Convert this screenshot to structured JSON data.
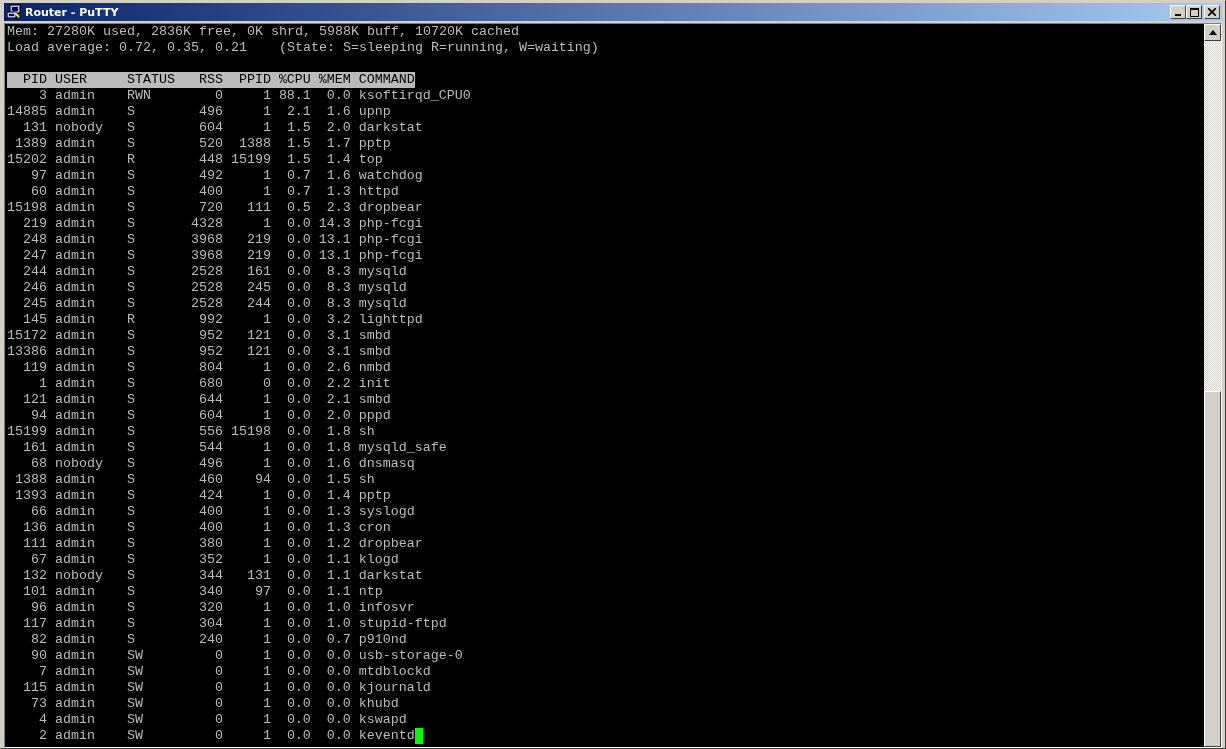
{
  "window": {
    "title": "Router - PuTTY"
  },
  "summary_lines": [
    "Mem: 27280K used, 2836K free, 0K shrd, 5988K buff, 10720K cached",
    "Load average: 0.72, 0.35, 0.21    (State: S=sleeping R=running, W=waiting)"
  ],
  "table": {
    "columns": [
      "PID",
      "USER",
      "STATUS",
      "RSS",
      "PPID",
      "%CPU",
      "%MEM",
      "COMMAND"
    ],
    "rows": [
      [
        "3",
        "admin",
        "RWN",
        "0",
        "1",
        "88.1",
        "0.0",
        "ksoftirqd_CPU0"
      ],
      [
        "14885",
        "admin",
        "S",
        "496",
        "1",
        "2.1",
        "1.6",
        "upnp"
      ],
      [
        "131",
        "nobody",
        "S",
        "604",
        "1",
        "1.5",
        "2.0",
        "darkstat"
      ],
      [
        "1389",
        "admin",
        "S",
        "520",
        "1388",
        "1.5",
        "1.7",
        "pptp"
      ],
      [
        "15202",
        "admin",
        "R",
        "448",
        "15199",
        "1.5",
        "1.4",
        "top"
      ],
      [
        "97",
        "admin",
        "S",
        "492",
        "1",
        "0.7",
        "1.6",
        "watchdog"
      ],
      [
        "60",
        "admin",
        "S",
        "400",
        "1",
        "0.7",
        "1.3",
        "httpd"
      ],
      [
        "15198",
        "admin",
        "S",
        "720",
        "111",
        "0.5",
        "2.3",
        "dropbear"
      ],
      [
        "219",
        "admin",
        "S",
        "4328",
        "1",
        "0.0",
        "14.3",
        "php-fcgi"
      ],
      [
        "248",
        "admin",
        "S",
        "3968",
        "219",
        "0.0",
        "13.1",
        "php-fcgi"
      ],
      [
        "247",
        "admin",
        "S",
        "3968",
        "219",
        "0.0",
        "13.1",
        "php-fcgi"
      ],
      [
        "244",
        "admin",
        "S",
        "2528",
        "161",
        "0.0",
        "8.3",
        "mysqld"
      ],
      [
        "246",
        "admin",
        "S",
        "2528",
        "245",
        "0.0",
        "8.3",
        "mysqld"
      ],
      [
        "245",
        "admin",
        "S",
        "2528",
        "244",
        "0.0",
        "8.3",
        "mysqld"
      ],
      [
        "145",
        "admin",
        "R",
        "992",
        "1",
        "0.0",
        "3.2",
        "lighttpd"
      ],
      [
        "15172",
        "admin",
        "S",
        "952",
        "121",
        "0.0",
        "3.1",
        "smbd"
      ],
      [
        "13386",
        "admin",
        "S",
        "952",
        "121",
        "0.0",
        "3.1",
        "smbd"
      ],
      [
        "119",
        "admin",
        "S",
        "804",
        "1",
        "0.0",
        "2.6",
        "nmbd"
      ],
      [
        "1",
        "admin",
        "S",
        "680",
        "0",
        "0.0",
        "2.2",
        "init"
      ],
      [
        "121",
        "admin",
        "S",
        "644",
        "1",
        "0.0",
        "2.1",
        "smbd"
      ],
      [
        "94",
        "admin",
        "S",
        "604",
        "1",
        "0.0",
        "2.0",
        "pppd"
      ],
      [
        "15199",
        "admin",
        "S",
        "556",
        "15198",
        "0.0",
        "1.8",
        "sh"
      ],
      [
        "161",
        "admin",
        "S",
        "544",
        "1",
        "0.0",
        "1.8",
        "mysqld_safe"
      ],
      [
        "68",
        "nobody",
        "S",
        "496",
        "1",
        "0.0",
        "1.6",
        "dnsmasq"
      ],
      [
        "1388",
        "admin",
        "S",
        "460",
        "94",
        "0.0",
        "1.5",
        "sh"
      ],
      [
        "1393",
        "admin",
        "S",
        "424",
        "1",
        "0.0",
        "1.4",
        "pptp"
      ],
      [
        "66",
        "admin",
        "S",
        "400",
        "1",
        "0.0",
        "1.3",
        "syslogd"
      ],
      [
        "136",
        "admin",
        "S",
        "400",
        "1",
        "0.0",
        "1.3",
        "cron"
      ],
      [
        "111",
        "admin",
        "S",
        "380",
        "1",
        "0.0",
        "1.2",
        "dropbear"
      ],
      [
        "67",
        "admin",
        "S",
        "352",
        "1",
        "0.0",
        "1.1",
        "klogd"
      ],
      [
        "132",
        "nobody",
        "S",
        "344",
        "131",
        "0.0",
        "1.1",
        "darkstat"
      ],
      [
        "101",
        "admin",
        "S",
        "340",
        "97",
        "0.0",
        "1.1",
        "ntp"
      ],
      [
        "96",
        "admin",
        "S",
        "320",
        "1",
        "0.0",
        "1.0",
        "infosvr"
      ],
      [
        "117",
        "admin",
        "S",
        "304",
        "1",
        "0.0",
        "1.0",
        "stupid-ftpd"
      ],
      [
        "82",
        "admin",
        "S",
        "240",
        "1",
        "0.0",
        "0.7",
        "p910nd"
      ],
      [
        "90",
        "admin",
        "SW",
        "0",
        "1",
        "0.0",
        "0.0",
        "usb-storage-0"
      ],
      [
        "7",
        "admin",
        "SW",
        "0",
        "1",
        "0.0",
        "0.0",
        "mtdblockd"
      ],
      [
        "115",
        "admin",
        "SW",
        "0",
        "1",
        "0.0",
        "0.0",
        "kjournald"
      ],
      [
        "73",
        "admin",
        "SW",
        "0",
        "1",
        "0.0",
        "0.0",
        "khubd"
      ],
      [
        "4",
        "admin",
        "SW",
        "0",
        "1",
        "0.0",
        "0.0",
        "kswapd"
      ],
      [
        "2",
        "admin",
        "SW",
        "0",
        "1",
        "0.0",
        "0.0",
        "keventd"
      ]
    ]
  }
}
